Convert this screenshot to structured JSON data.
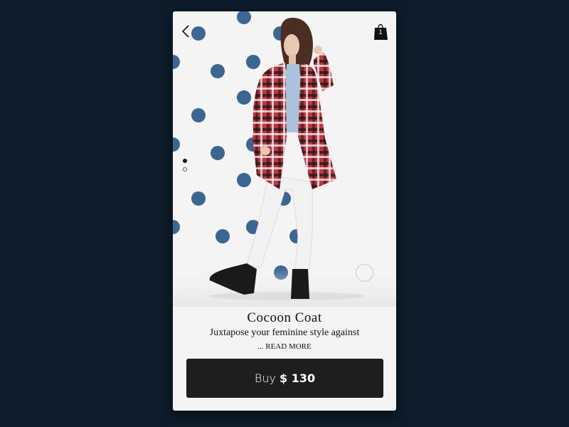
{
  "cart": {
    "count": "1"
  },
  "product": {
    "title": "Cocoon Coat",
    "description": "Juxtapose your feminine style against",
    "read_more": "... READ MORE",
    "image_alt": "Model wearing a red and black plaid cocoon coat with white jeans and black ankle boots"
  },
  "buy": {
    "label": "Buy",
    "price": "$ 130"
  },
  "carousel": {
    "slides": 2,
    "active_index": 0
  },
  "colors": {
    "background": "#0d1d2b",
    "card": "#f4f4f4",
    "polka_dot": "#2c5a8a",
    "button": "#1e1e1e",
    "coat_red": "#c8323c"
  },
  "icons": [
    "back-chevron-icon",
    "shopping-bag-icon"
  ]
}
